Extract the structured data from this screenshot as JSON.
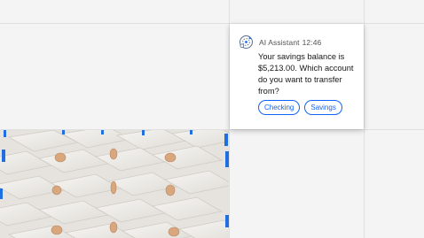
{
  "chat": {
    "sender": "AI Assistant",
    "time": "12:46",
    "message": "Your savings balance is $5,213.00. Which account do you want to transfer from?",
    "options": [
      "Checking",
      "Savings"
    ]
  },
  "colors": {
    "accent": "#0f62fe",
    "background": "#f4f4f4"
  },
  "icons": {
    "avatar": "ai-assistant-icon"
  }
}
